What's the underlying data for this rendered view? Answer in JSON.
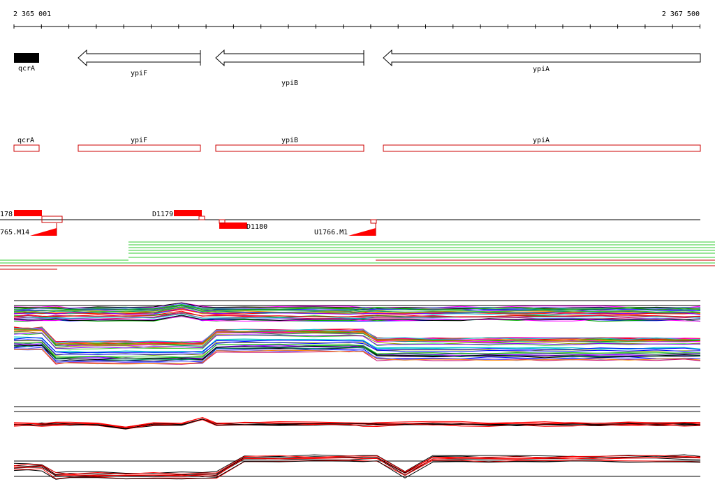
{
  "ruler": {
    "start_label": "2 365 001",
    "end_label": "2 367 500",
    "start": 2365001,
    "end": 2367500
  },
  "genes": [
    {
      "name": "qcrA",
      "start": 2365001,
      "end": 2365093,
      "strand": "+"
    },
    {
      "name": "ypiF",
      "start": 2365237,
      "end": 2365830,
      "strand": "-"
    },
    {
      "name": "ypiB",
      "start": 2365732,
      "end": 2366293,
      "strand": "-"
    },
    {
      "name": "ypiA",
      "start": 2366363,
      "end": 2367500,
      "strand": "-"
    }
  ],
  "regions": [
    {
      "name": "D1179"
    },
    {
      "name": "D1180"
    },
    {
      "name": "U1766.M1"
    },
    {
      "name": "178"
    },
    {
      "name": "765.M14"
    }
  ],
  "colors": {
    "gene_fill": "#000000",
    "annotation_box": "#cc0000",
    "segment_red": "#ff0000",
    "track_green": "#33cc33",
    "track_red": "#cc0000"
  }
}
